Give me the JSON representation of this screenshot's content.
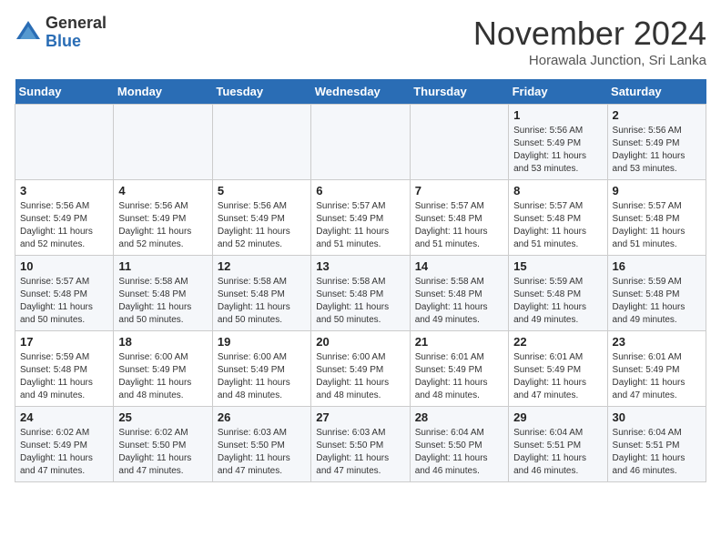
{
  "header": {
    "logo_general": "General",
    "logo_blue": "Blue",
    "month": "November 2024",
    "location": "Horawala Junction, Sri Lanka"
  },
  "weekdays": [
    "Sunday",
    "Monday",
    "Tuesday",
    "Wednesday",
    "Thursday",
    "Friday",
    "Saturday"
  ],
  "weeks": [
    [
      {
        "day": "",
        "info": ""
      },
      {
        "day": "",
        "info": ""
      },
      {
        "day": "",
        "info": ""
      },
      {
        "day": "",
        "info": ""
      },
      {
        "day": "",
        "info": ""
      },
      {
        "day": "1",
        "info": "Sunrise: 5:56 AM\nSunset: 5:49 PM\nDaylight: 11 hours\nand 53 minutes."
      },
      {
        "day": "2",
        "info": "Sunrise: 5:56 AM\nSunset: 5:49 PM\nDaylight: 11 hours\nand 53 minutes."
      }
    ],
    [
      {
        "day": "3",
        "info": "Sunrise: 5:56 AM\nSunset: 5:49 PM\nDaylight: 11 hours\nand 52 minutes."
      },
      {
        "day": "4",
        "info": "Sunrise: 5:56 AM\nSunset: 5:49 PM\nDaylight: 11 hours\nand 52 minutes."
      },
      {
        "day": "5",
        "info": "Sunrise: 5:56 AM\nSunset: 5:49 PM\nDaylight: 11 hours\nand 52 minutes."
      },
      {
        "day": "6",
        "info": "Sunrise: 5:57 AM\nSunset: 5:49 PM\nDaylight: 11 hours\nand 51 minutes."
      },
      {
        "day": "7",
        "info": "Sunrise: 5:57 AM\nSunset: 5:48 PM\nDaylight: 11 hours\nand 51 minutes."
      },
      {
        "day": "8",
        "info": "Sunrise: 5:57 AM\nSunset: 5:48 PM\nDaylight: 11 hours\nand 51 minutes."
      },
      {
        "day": "9",
        "info": "Sunrise: 5:57 AM\nSunset: 5:48 PM\nDaylight: 11 hours\nand 51 minutes."
      }
    ],
    [
      {
        "day": "10",
        "info": "Sunrise: 5:57 AM\nSunset: 5:48 PM\nDaylight: 11 hours\nand 50 minutes."
      },
      {
        "day": "11",
        "info": "Sunrise: 5:58 AM\nSunset: 5:48 PM\nDaylight: 11 hours\nand 50 minutes."
      },
      {
        "day": "12",
        "info": "Sunrise: 5:58 AM\nSunset: 5:48 PM\nDaylight: 11 hours\nand 50 minutes."
      },
      {
        "day": "13",
        "info": "Sunrise: 5:58 AM\nSunset: 5:48 PM\nDaylight: 11 hours\nand 50 minutes."
      },
      {
        "day": "14",
        "info": "Sunrise: 5:58 AM\nSunset: 5:48 PM\nDaylight: 11 hours\nand 49 minutes."
      },
      {
        "day": "15",
        "info": "Sunrise: 5:59 AM\nSunset: 5:48 PM\nDaylight: 11 hours\nand 49 minutes."
      },
      {
        "day": "16",
        "info": "Sunrise: 5:59 AM\nSunset: 5:48 PM\nDaylight: 11 hours\nand 49 minutes."
      }
    ],
    [
      {
        "day": "17",
        "info": "Sunrise: 5:59 AM\nSunset: 5:48 PM\nDaylight: 11 hours\nand 49 minutes."
      },
      {
        "day": "18",
        "info": "Sunrise: 6:00 AM\nSunset: 5:49 PM\nDaylight: 11 hours\nand 48 minutes."
      },
      {
        "day": "19",
        "info": "Sunrise: 6:00 AM\nSunset: 5:49 PM\nDaylight: 11 hours\nand 48 minutes."
      },
      {
        "day": "20",
        "info": "Sunrise: 6:00 AM\nSunset: 5:49 PM\nDaylight: 11 hours\nand 48 minutes."
      },
      {
        "day": "21",
        "info": "Sunrise: 6:01 AM\nSunset: 5:49 PM\nDaylight: 11 hours\nand 48 minutes."
      },
      {
        "day": "22",
        "info": "Sunrise: 6:01 AM\nSunset: 5:49 PM\nDaylight: 11 hours\nand 47 minutes."
      },
      {
        "day": "23",
        "info": "Sunrise: 6:01 AM\nSunset: 5:49 PM\nDaylight: 11 hours\nand 47 minutes."
      }
    ],
    [
      {
        "day": "24",
        "info": "Sunrise: 6:02 AM\nSunset: 5:49 PM\nDaylight: 11 hours\nand 47 minutes."
      },
      {
        "day": "25",
        "info": "Sunrise: 6:02 AM\nSunset: 5:50 PM\nDaylight: 11 hours\nand 47 minutes."
      },
      {
        "day": "26",
        "info": "Sunrise: 6:03 AM\nSunset: 5:50 PM\nDaylight: 11 hours\nand 47 minutes."
      },
      {
        "day": "27",
        "info": "Sunrise: 6:03 AM\nSunset: 5:50 PM\nDaylight: 11 hours\nand 47 minutes."
      },
      {
        "day": "28",
        "info": "Sunrise: 6:04 AM\nSunset: 5:50 PM\nDaylight: 11 hours\nand 46 minutes."
      },
      {
        "day": "29",
        "info": "Sunrise: 6:04 AM\nSunset: 5:51 PM\nDaylight: 11 hours\nand 46 minutes."
      },
      {
        "day": "30",
        "info": "Sunrise: 6:04 AM\nSunset: 5:51 PM\nDaylight: 11 hours\nand 46 minutes."
      }
    ]
  ]
}
